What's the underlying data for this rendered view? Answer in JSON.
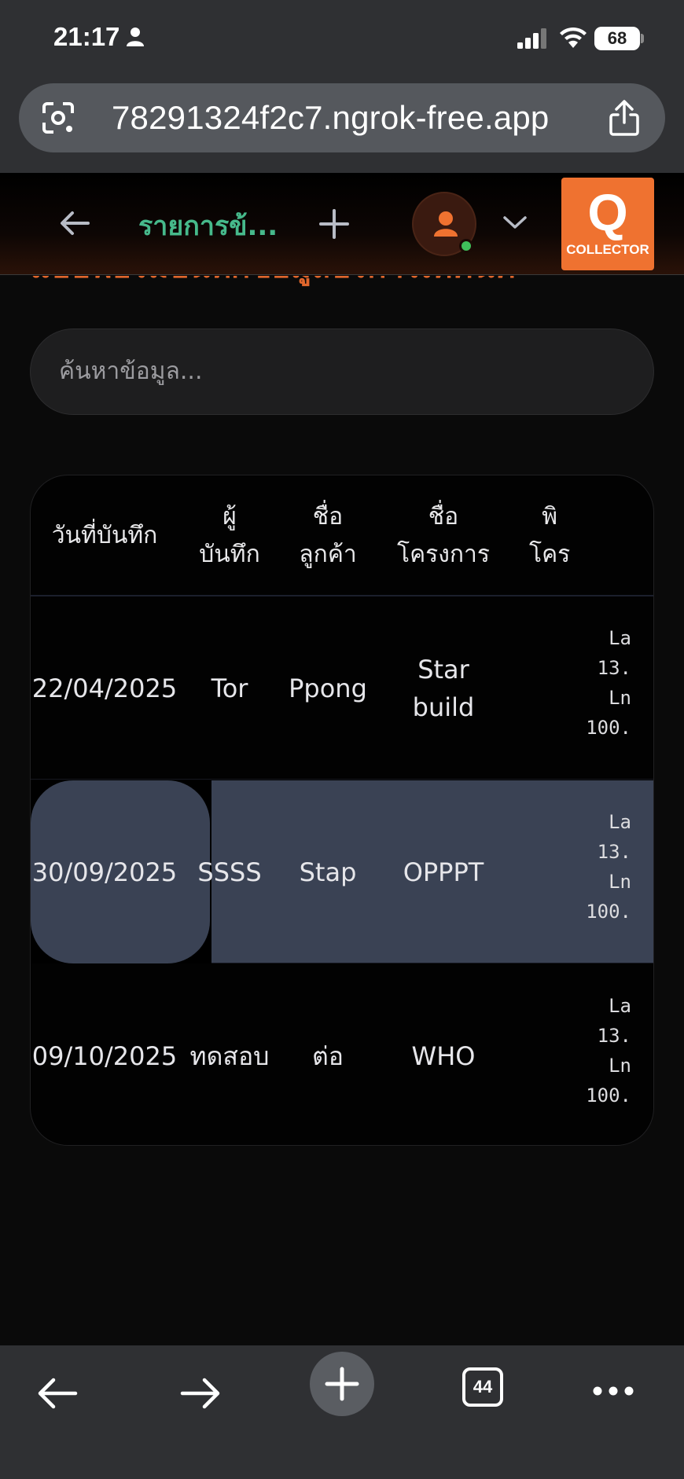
{
  "status_bar": {
    "time": "21:17",
    "battery": "68"
  },
  "browser": {
    "url": "78291324f2c7.ngrok-free.app",
    "tab_count": "44"
  },
  "header": {
    "title": "รายการข้...",
    "logo_letter": "Q",
    "logo_text": "COLLECTOR",
    "accent_color": "#ef7230",
    "title_color": "#46b98b"
  },
  "page": {
    "peek_heading": "แบบฟอร์มบันทึกข้อมูลบริการเทคนิค"
  },
  "search": {
    "placeholder": "ค้นหาข้อมูล...",
    "value": ""
  },
  "table": {
    "columns": [
      "วันที่บันทึก",
      "ผู้\nบันทึก",
      "ชื่อ\nลูกค้า",
      "ชื่อ\nโครงการ",
      "พิ\nโคร"
    ],
    "rows": [
      {
        "date": "22/04/2025",
        "recorder": "Tor",
        "customer": "Ppong",
        "project": "Star\nbuild",
        "location": "La\n13.\nLn\n100."
      },
      {
        "date": "30/09/2025",
        "recorder": "SSSS",
        "customer": "Stap",
        "project": "OPPPT",
        "location": "La\n13.\nLn\n100."
      },
      {
        "date": "09/10/2025",
        "recorder": "ทดสอบ",
        "customer": "ต่อ",
        "project": "WHO",
        "location": "La\n13.\nLn\n100."
      }
    ],
    "selected_row": 1
  }
}
